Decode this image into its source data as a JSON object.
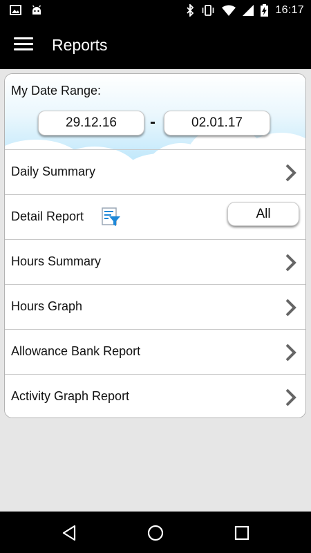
{
  "status_bar": {
    "time": "16:17",
    "left_icons": [
      "image-icon",
      "android-icon"
    ],
    "right_icons": [
      "bluetooth-icon",
      "vibrate-icon",
      "wifi-icon",
      "signal-icon",
      "battery-charging-icon"
    ]
  },
  "app_bar": {
    "title": "Reports",
    "menu_icon": "hamburger-menu-icon"
  },
  "date_range": {
    "label": "My Date Range:",
    "start": "29.12.16",
    "separator": "-",
    "end": "02.01.17"
  },
  "reports": [
    {
      "label": "Daily Summary",
      "icon": "chevron-right-icon"
    },
    {
      "label": "Detail Report",
      "filter_icon": "filter-icon",
      "filter_value": "All"
    },
    {
      "label": "Hours Summary",
      "icon": "chevron-right-icon"
    },
    {
      "label": "Hours Graph",
      "icon": "chevron-right-icon"
    },
    {
      "label": "Allowance Bank Report",
      "icon": "chevron-right-icon"
    },
    {
      "label": "Activity Graph Report",
      "icon": "chevron-right-icon"
    }
  ],
  "nav_bar": {
    "buttons": [
      "back-icon",
      "home-icon",
      "recents-icon"
    ]
  },
  "colors": {
    "bar": "#000000",
    "background": "#e6e6e6",
    "sky": "#b6e3fa",
    "chevron": "#666666",
    "filter_blue": "#1e88d8"
  }
}
